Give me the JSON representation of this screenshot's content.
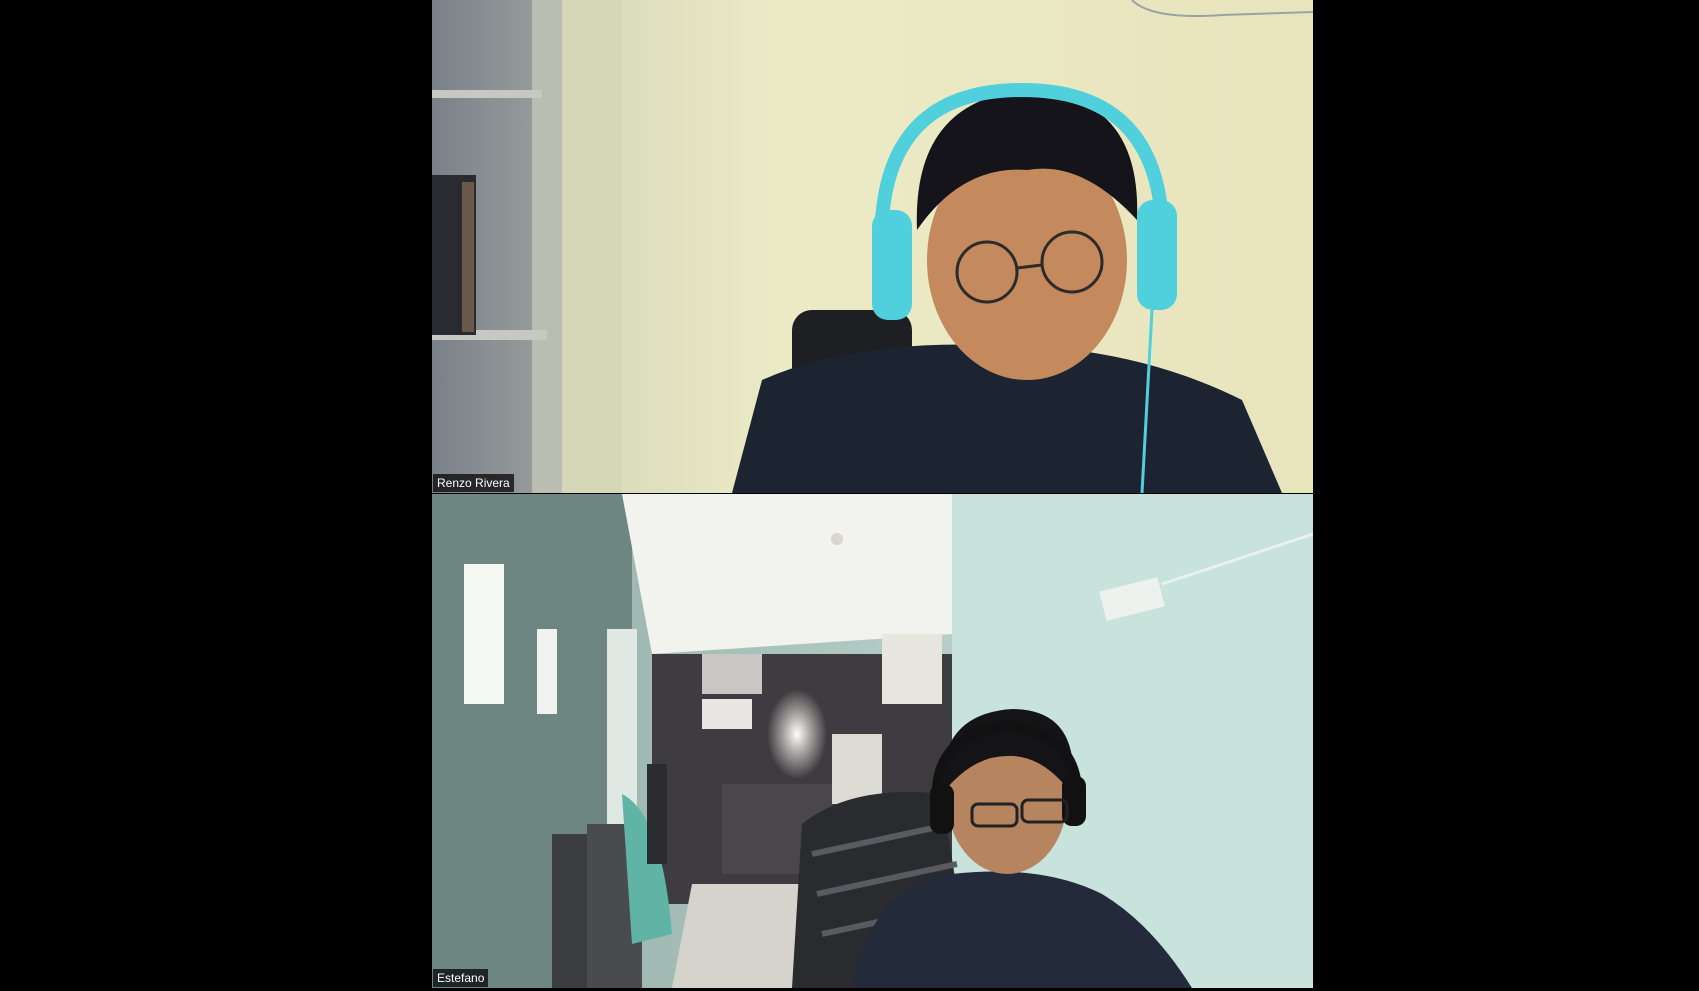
{
  "meeting": {
    "participants": [
      {
        "name": "Renzo Rivera"
      },
      {
        "name": "Estefano"
      }
    ]
  },
  "colors": {
    "background": "#000000",
    "name_tag_bg": "rgba(0,0,0,0.72)",
    "name_tag_text": "#ffffff"
  }
}
